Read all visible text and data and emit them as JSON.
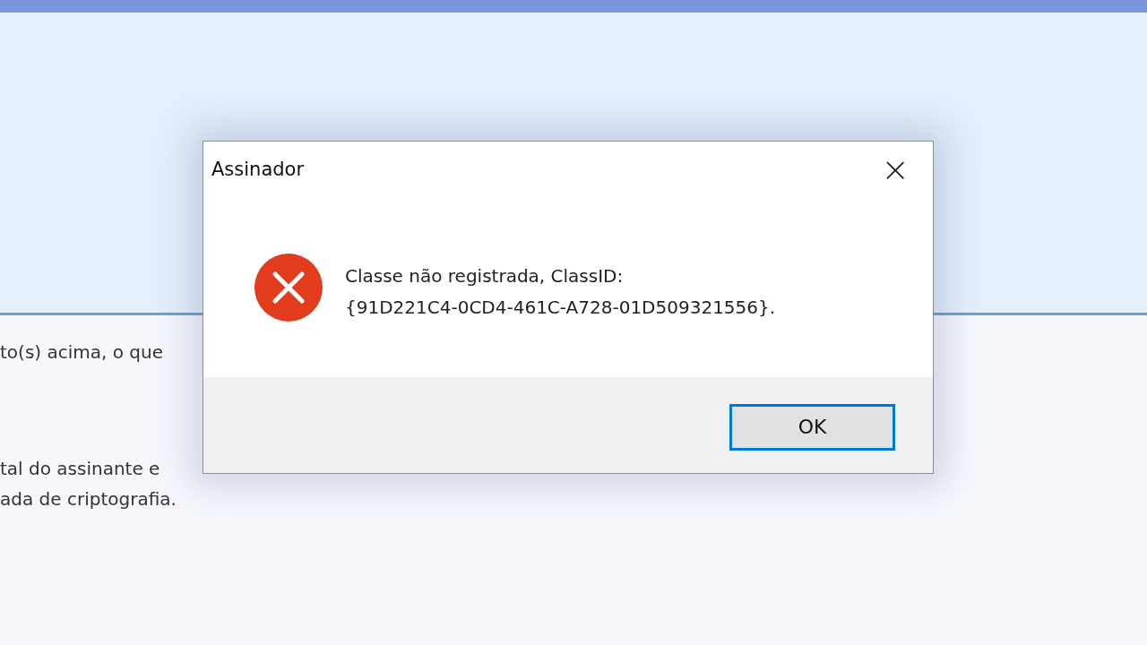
{
  "background": {
    "lines": [
      "to(s) acima, o que",
      "tal do assinante e",
      "ada de criptografia."
    ]
  },
  "dialog": {
    "title": "Assinador",
    "close": "×",
    "kind": "error",
    "message": [
      "Classe não registrada, ClassID:",
      "{91D221C4-0CD4-461C-A728-01D509321556}."
    ],
    "buttons": [
      {
        "label": "OK",
        "selected": true
      }
    ]
  }
}
